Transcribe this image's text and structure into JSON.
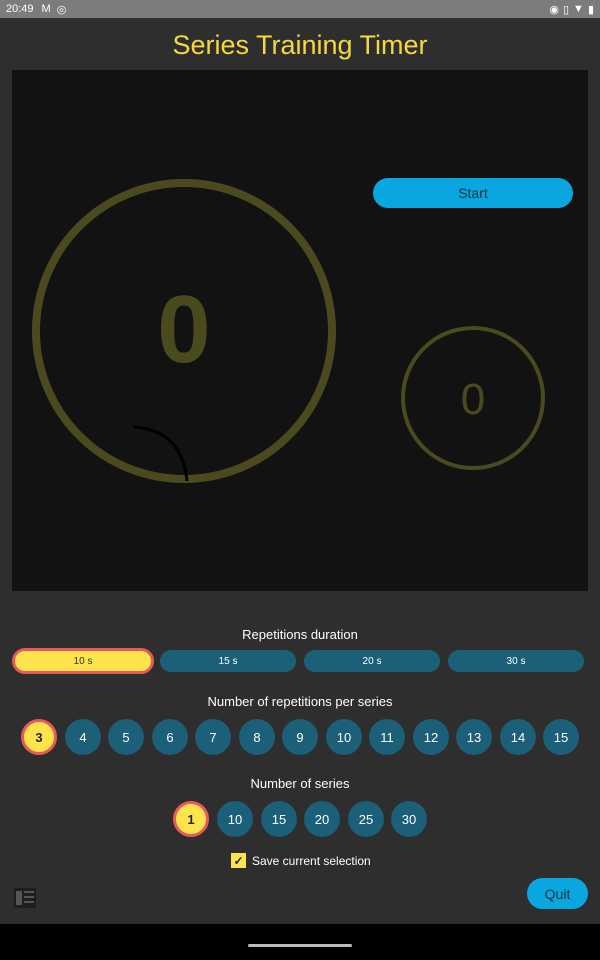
{
  "status_bar": {
    "time": "20:49",
    "left_icons": [
      "gmail-icon",
      "messenger-icon"
    ],
    "right_icons": [
      "eye-icon",
      "vibrate-icon",
      "wifi-icon",
      "battery-icon"
    ]
  },
  "app": {
    "title": "Series Training Timer"
  },
  "stage": {
    "big_counter": "0",
    "small_counter": "0",
    "start_label": "Start"
  },
  "durations": {
    "label": "Repetitions duration",
    "options": [
      "10 s",
      "15 s",
      "20 s",
      "30 s"
    ],
    "selected": "10 s"
  },
  "repetitions": {
    "label": "Number of repetitions per series",
    "options": [
      "3",
      "4",
      "5",
      "6",
      "7",
      "8",
      "9",
      "10",
      "11",
      "12",
      "13",
      "14",
      "15"
    ],
    "selected": "3"
  },
  "series": {
    "label": "Number of series",
    "options": [
      "1",
      "10",
      "15",
      "20",
      "25",
      "30"
    ],
    "selected": "1"
  },
  "save": {
    "label": "Save current selection",
    "checked": true
  },
  "footer": {
    "quit_label": "Quit"
  },
  "colors": {
    "accent_yellow": "#f5d93a",
    "button_blue": "#0aa6e0",
    "chip_teal": "#1c5f78",
    "selected_border": "#e85a5a",
    "ring_olive": "#4b4a1e"
  }
}
